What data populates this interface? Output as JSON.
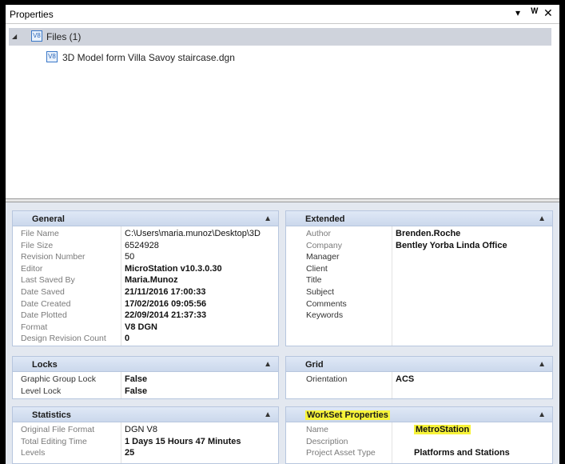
{
  "window": {
    "title": "Properties",
    "pin_glyph": "▾",
    "pin2_glyph": "ᴖ",
    "close_glyph": "✕"
  },
  "tree": {
    "root_label": "Files (1)",
    "root_icon": "v8-file-icon",
    "child_label": "3D Model form Villa Savoy staircase.dgn",
    "icon_text": "V8"
  },
  "sections": {
    "general": {
      "title": "General",
      "rows": [
        {
          "key": "File Name",
          "value": "C:\\Users\\maria.munoz\\Desktop\\3D"
        },
        {
          "key": "File Size",
          "value": "6524928"
        },
        {
          "key": "Revision Number",
          "value": "50"
        },
        {
          "key": "Editor",
          "value": "MicroStation v10.3.0.30"
        },
        {
          "key": "Last Saved By",
          "value": "Maria.Munoz"
        },
        {
          "key": "Date Saved",
          "value": "21/11/2016 17:00:33"
        },
        {
          "key": "Date Created",
          "value": "17/02/2016 09:05:56"
        },
        {
          "key": "Date Plotted",
          "value": "22/09/2014 21:37:33"
        },
        {
          "key": "Format",
          "value": "V8 DGN"
        },
        {
          "key": "Design Revision Count",
          "value": "0"
        }
      ]
    },
    "extended": {
      "title": "Extended",
      "rows": [
        {
          "key": "Author",
          "value": "Brenden.Roche"
        },
        {
          "key": "Company",
          "value": "Bentley Yorba Linda Office"
        },
        {
          "key": "Manager",
          "value": ""
        },
        {
          "key": "Client",
          "value": ""
        },
        {
          "key": "Title",
          "value": ""
        },
        {
          "key": "Subject",
          "value": ""
        },
        {
          "key": "Comments",
          "value": ""
        },
        {
          "key": "Keywords",
          "value": ""
        }
      ]
    },
    "locks": {
      "title": "Locks",
      "rows": [
        {
          "key": "Graphic Group Lock",
          "value": "False"
        },
        {
          "key": "Level Lock",
          "value": "False"
        }
      ]
    },
    "grid": {
      "title": "Grid",
      "rows": [
        {
          "key": "Orientation",
          "value": "ACS"
        }
      ]
    },
    "statistics": {
      "title": "Statistics",
      "rows": [
        {
          "key": "Original File Format",
          "value": "DGN V8"
        },
        {
          "key": "Total Editing Time",
          "value": "1 Days 15 Hours 47 Minutes"
        },
        {
          "key": "Levels",
          "value": "25"
        }
      ]
    },
    "workset": {
      "title": "WorkSet Properties",
      "rows": [
        {
          "key": "Name",
          "value": "MetroStation"
        },
        {
          "key": "Description",
          "value": ""
        },
        {
          "key": "Project Asset Type",
          "value": "Platforms and Stations"
        }
      ]
    }
  },
  "collapse_glyph": "▲",
  "colors": {
    "highlight": "#f7f339",
    "section_header": "#cbd8ec",
    "selected_row": "#cfd3dc"
  }
}
